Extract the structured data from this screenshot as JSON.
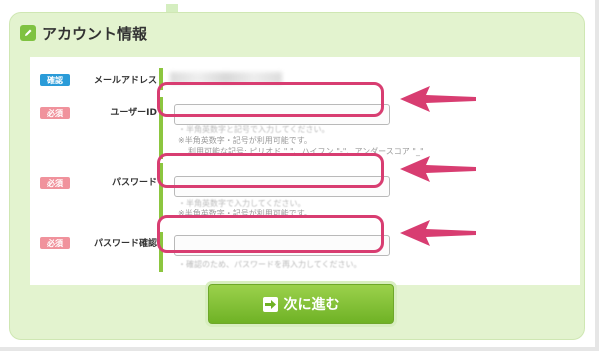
{
  "panel": {
    "title": "アカウント情報",
    "icon": "pencil-icon"
  },
  "badges": {
    "confirm": "確認",
    "required": "必須"
  },
  "fields": [
    {
      "label": "メールアドレス",
      "badge": "確認",
      "value": ""
    },
    {
      "label": "ユーザーID",
      "badge": "必須",
      "value": "",
      "hints": [
        "・半角英数字と記号で入力してください。",
        "※半角英数字・記号が利用可能です。",
        "利用可能な記号: ピリオド \".\"、ハイフン \"-\"、アンダースコア \"_\""
      ]
    },
    {
      "label": "パスワード",
      "badge": "必須",
      "value": "",
      "hints": [
        "・半角英数字で入力してください。",
        "※半角英数字・記号が利用可能です。"
      ]
    },
    {
      "label": "パスワード確認",
      "badge": "必須",
      "value": "",
      "hints": [
        "・確認のため、パスワードを再入力してください。"
      ]
    }
  ],
  "submit": {
    "label": "次に進む",
    "icon": "arrow-right-icon"
  },
  "colors": {
    "accent_green": "#8cc63f",
    "highlight": "#d83d71",
    "badge_blue": "#2a9bd8",
    "badge_pink": "#f0929c"
  }
}
